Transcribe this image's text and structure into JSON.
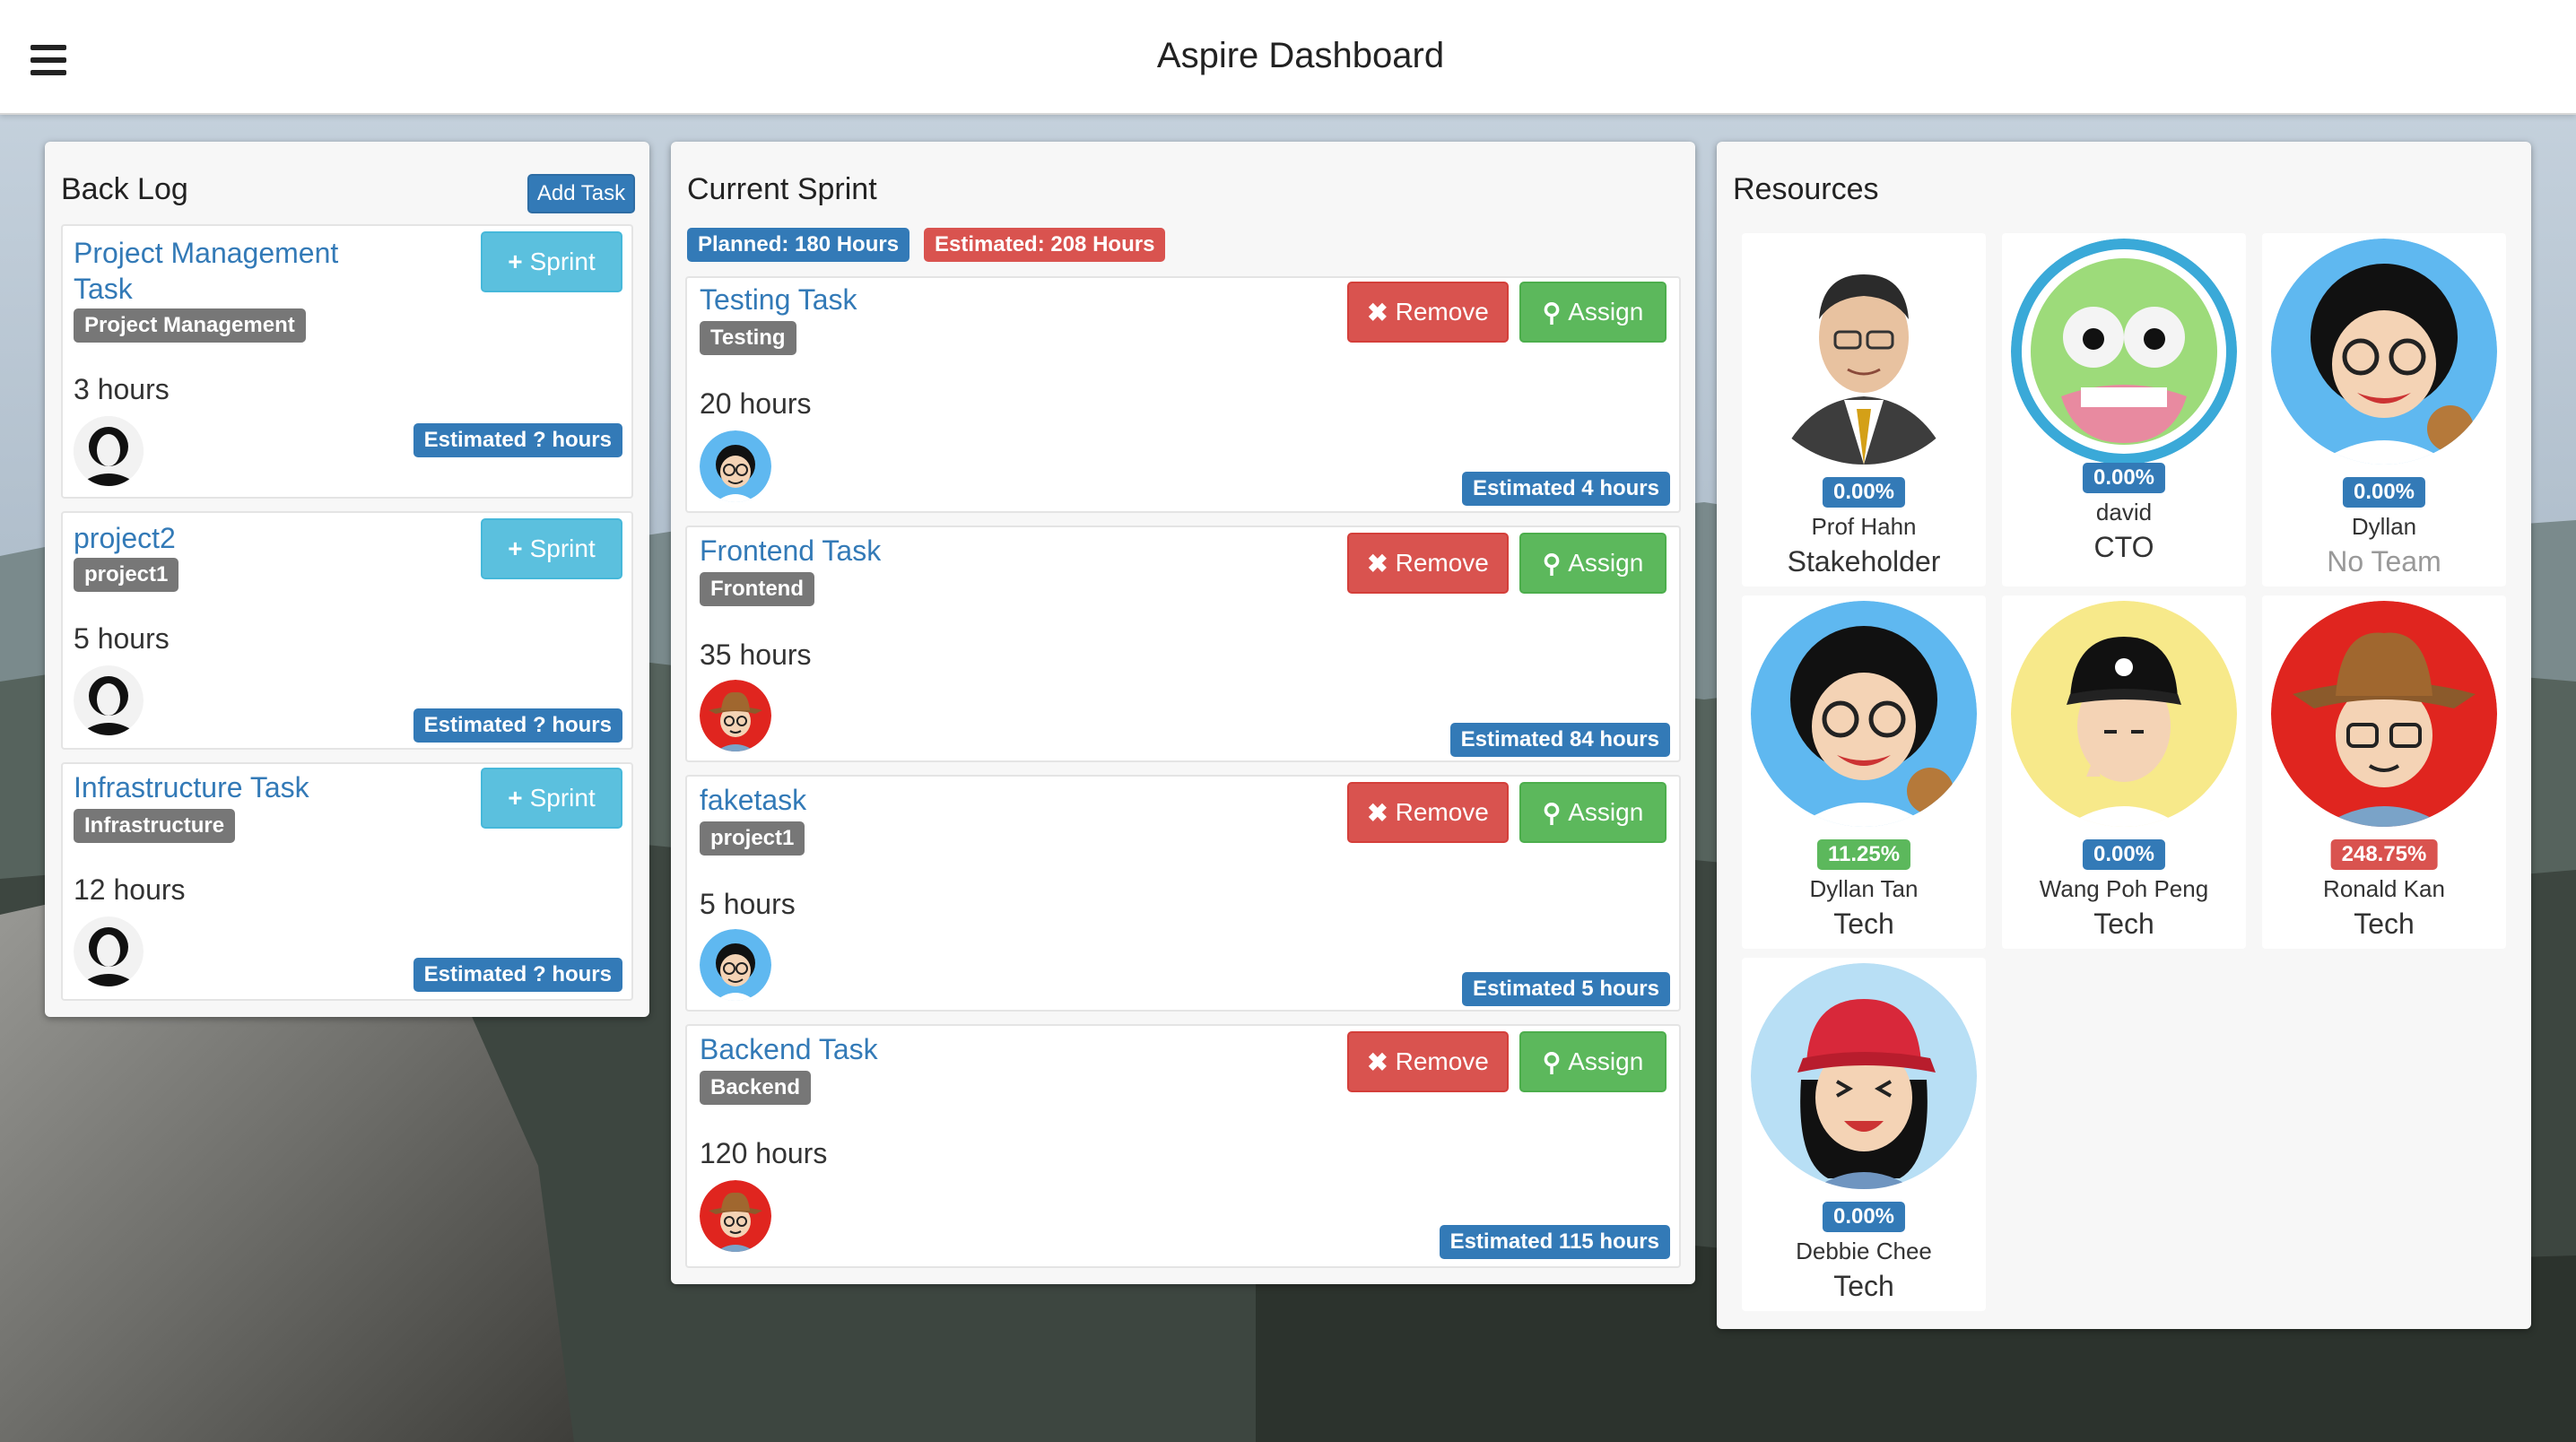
{
  "header": {
    "title": "Aspire Dashboard"
  },
  "backlog": {
    "title": "Back Log",
    "add_label": "Add Task",
    "sprint_label": "Sprint",
    "tasks": [
      {
        "title_line1": "Project Management",
        "title_line2": "Task",
        "tag": "Project Management",
        "hours": "3 hours",
        "estimate": "Estimated ? hours"
      },
      {
        "title_line1": "project2",
        "title_line2": "",
        "tag": "project1",
        "hours": "5 hours",
        "estimate": "Estimated ? hours"
      },
      {
        "title_line1": "Infrastructure Task",
        "title_line2": "",
        "tag": "Infrastructure",
        "hours": "12 hours",
        "estimate": "Estimated ? hours"
      }
    ]
  },
  "sprint": {
    "title": "Current Sprint",
    "planned": "Planned: 180 Hours",
    "estimated": "Estimated: 208 Hours",
    "remove_label": "Remove",
    "assign_label": "Assign",
    "tasks": [
      {
        "title": "Testing Task",
        "tag": "Testing",
        "hours": "20 hours",
        "estimate": "Estimated 4 hours",
        "assignee_icon": "curly-hair-glasses-avatar"
      },
      {
        "title": "Frontend Task",
        "tag": "Frontend",
        "hours": "35 hours",
        "estimate": "Estimated 84 hours",
        "assignee_icon": "cowboy-hat-avatar"
      },
      {
        "title": "faketask",
        "tag": "project1",
        "hours": "5 hours",
        "estimate": "Estimated 5 hours",
        "assignee_icon": "curly-hair-glasses-avatar"
      },
      {
        "title": "Backend Task",
        "tag": "Backend",
        "hours": "120 hours",
        "estimate": "Estimated 115 hours",
        "assignee_icon": "cowboy-hat-avatar"
      }
    ]
  },
  "resources": {
    "title": "Resources",
    "people": [
      {
        "name": "Prof Hahn",
        "team": "Stakeholder",
        "percent": "0.00%",
        "badge_color": "#337ab7"
      },
      {
        "name": "david",
        "team": "CTO",
        "percent": "0.00%",
        "badge_color": "#337ab7"
      },
      {
        "name": "Dyllan",
        "team": "No Team",
        "percent": "0.00%",
        "badge_color": "#337ab7"
      },
      {
        "name": "Dyllan Tan",
        "team": "Tech",
        "percent": "11.25%",
        "badge_color": "#5cb85c"
      },
      {
        "name": "Wang Poh Peng",
        "team": "Tech",
        "percent": "0.00%",
        "badge_color": "#337ab7"
      },
      {
        "name": "Ronald Kan",
        "team": "Tech",
        "percent": "248.75%",
        "badge_color": "#d9534f"
      },
      {
        "name": "Debbie Chee",
        "team": "Tech",
        "percent": "0.00%",
        "badge_color": "#337ab7"
      }
    ]
  },
  "colors": {
    "primary": "#337ab7",
    "info": "#5bc0de",
    "danger": "#d9534f",
    "success": "#5cb85c",
    "tag_gray": "#777777"
  }
}
